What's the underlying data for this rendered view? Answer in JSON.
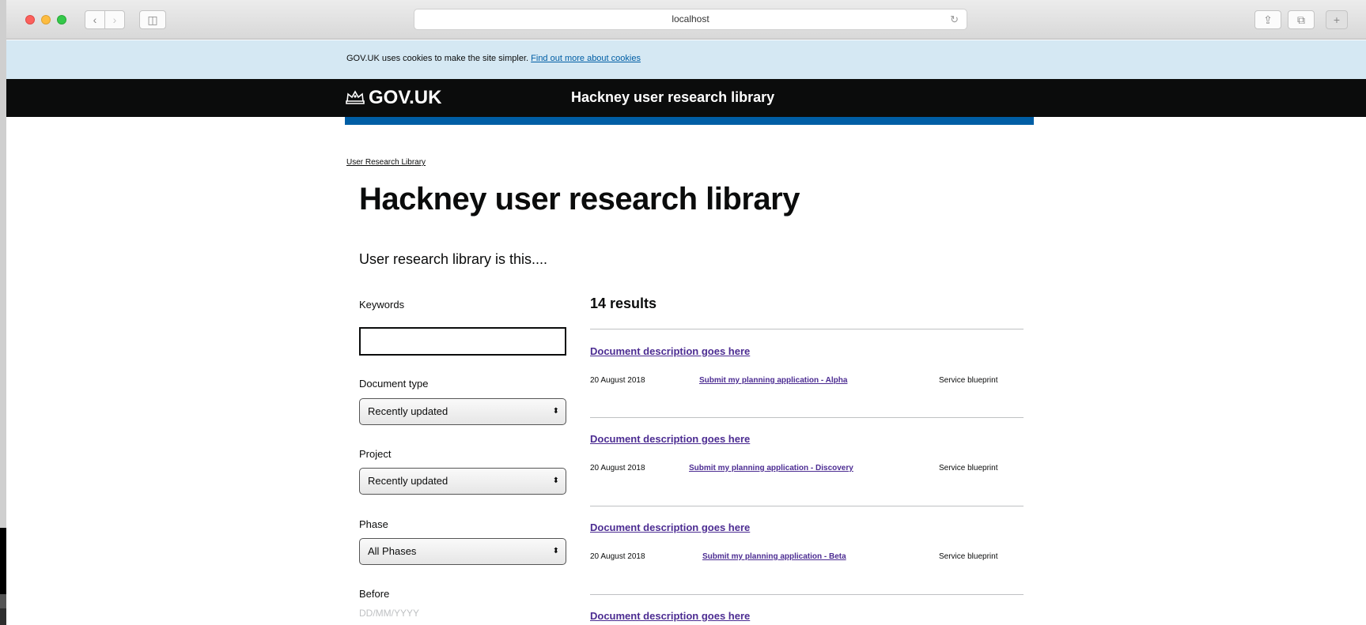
{
  "browser": {
    "url": "localhost",
    "back_glyph": "‹",
    "forward_glyph": "›",
    "sidebar_glyph": "◫",
    "reload_glyph": "↻",
    "share_glyph": "⇪",
    "tabs_glyph": "⧉",
    "newtab_glyph": "+"
  },
  "cookie_banner": {
    "text": "GOV.UK uses cookies to make the site simpler.",
    "link": "Find out more about cookies"
  },
  "header": {
    "logo": "GOV.UK",
    "service_name": "Hackney user research library"
  },
  "breadcrumb": "User Research Library",
  "page": {
    "title": "Hackney user research library",
    "lede": "User research library is this...."
  },
  "filters": {
    "keywords_label": "Keywords",
    "keywords_value": "",
    "document_type_label": "Document type",
    "document_type_value": "Recently updated",
    "project_label": "Project",
    "project_value": "Recently updated",
    "phase_label": "Phase",
    "phase_value": "All Phases",
    "before_label": "Before",
    "before_placeholder": "DD/MM/YYYY",
    "select_arrow": "⬍"
  },
  "results": {
    "count_text": "14 results",
    "items": [
      {
        "title": "Document description goes here",
        "date": "20 August 2018",
        "project": "Submit my planning application - Alpha",
        "type": "Service blueprint"
      },
      {
        "title": "Document description goes here",
        "date": "20 August 2018",
        "project": "Submit my planning application - Discovery",
        "type": "Service blueprint"
      },
      {
        "title": "Document description goes here",
        "date": "20 August 2018",
        "project": "Submit my planning application - Beta",
        "type": "Service blueprint"
      },
      {
        "title": "Document description goes here"
      }
    ]
  },
  "colors": {
    "header_bg": "#0b0c0c",
    "brand_blue": "#005ea5",
    "link_visited": "#4c2c92",
    "cookie_bg": "#d5e8f3"
  }
}
